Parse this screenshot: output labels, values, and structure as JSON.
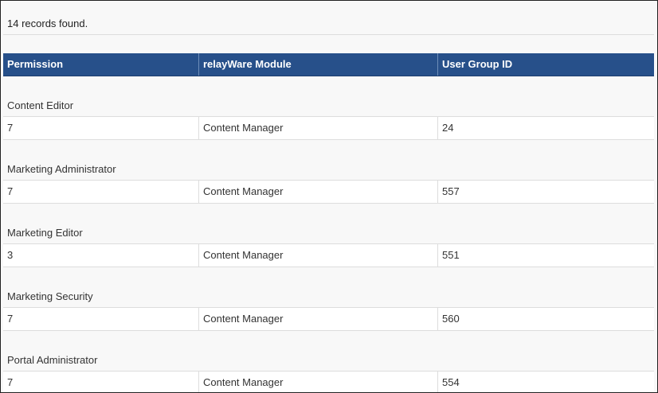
{
  "summary": {
    "records_text": "14 records found."
  },
  "table": {
    "columns": [
      "Permission",
      "relayWare Module",
      "User Group ID"
    ],
    "groups": [
      {
        "name": "Content Editor",
        "rows": [
          {
            "permission": "7",
            "module": "Content Manager",
            "user_group_id": "24"
          }
        ]
      },
      {
        "name": "Marketing Administrator",
        "rows": [
          {
            "permission": "7",
            "module": "Content Manager",
            "user_group_id": "557"
          }
        ]
      },
      {
        "name": "Marketing Editor",
        "rows": [
          {
            "permission": "3",
            "module": "Content Manager",
            "user_group_id": "551"
          }
        ]
      },
      {
        "name": "Marketing Security",
        "rows": [
          {
            "permission": "7",
            "module": "Content Manager",
            "user_group_id": "560"
          }
        ]
      },
      {
        "name": "Portal Administrator",
        "rows": [
          {
            "permission": "7",
            "module": "Content Manager",
            "user_group_id": "554"
          }
        ]
      }
    ]
  },
  "colors": {
    "header_background": "#27508a",
    "header_text": "#ffffff",
    "row_background": "#ffffff",
    "group_background": "#f8f8f8"
  }
}
